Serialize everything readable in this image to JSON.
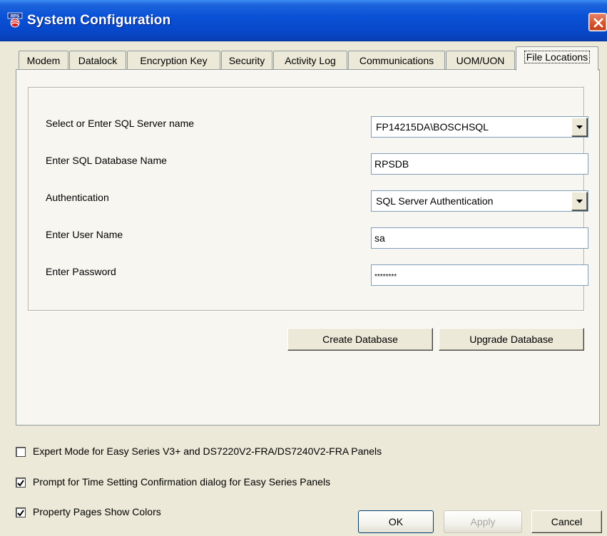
{
  "window": {
    "title": "System Configuration",
    "app_icon": "rps-app-icon",
    "close_icon": "close-icon"
  },
  "tabs": [
    {
      "label": "Modem",
      "active": false
    },
    {
      "label": "Datalock",
      "active": false
    },
    {
      "label": "Encryption Key",
      "active": false
    },
    {
      "label": "Security",
      "active": false
    },
    {
      "label": "Activity Log",
      "active": false
    },
    {
      "label": "Communications",
      "active": false
    },
    {
      "label": "UOM/UON",
      "active": false
    },
    {
      "label": "File Locations",
      "active": true
    }
  ],
  "form": {
    "server_label": "Select or Enter SQL Server name",
    "server_value": "FP14215DA\\BOSCHSQL",
    "db_label": "Enter SQL Database Name",
    "db_value": "RPSDB",
    "auth_label": "Authentication",
    "auth_value": "SQL Server Authentication",
    "user_label": "Enter User Name",
    "user_value": "sa",
    "password_label": "Enter Password",
    "password_value": "********"
  },
  "buttons": {
    "create_db": "Create Database",
    "upgrade_db": "Upgrade Database",
    "ok": "OK",
    "apply": "Apply",
    "cancel": "Cancel"
  },
  "checkboxes": [
    {
      "label": "Expert Mode for Easy Series V3+ and DS7220V2-FRA/DS7240V2-FRA Panels",
      "checked": false
    },
    {
      "label": "Prompt for Time Setting Confirmation dialog for Easy Series Panels",
      "checked": true
    },
    {
      "label": "Property Pages Show Colors",
      "checked": true
    }
  ],
  "colors": {
    "title_bar": "#0a52d6",
    "dialog_bg": "#ece9d8",
    "close_button": "#d6522c"
  }
}
